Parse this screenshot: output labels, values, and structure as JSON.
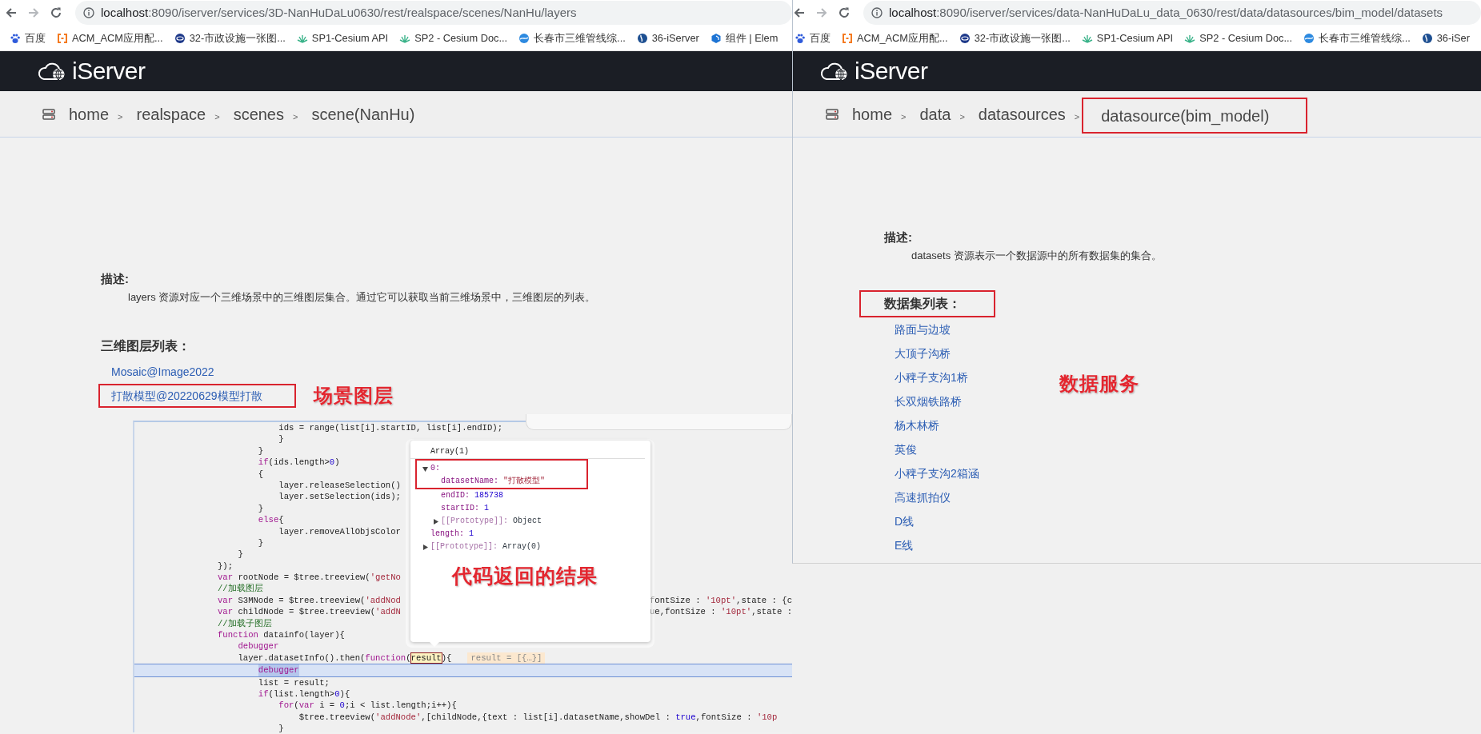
{
  "left_window": {
    "address_bar": {
      "host": "localhost",
      "path": ":8090/iserver/services/3D-NanHuDaLu0630/rest/realspace/scenes/NanHu/layers"
    },
    "bookmarks": [
      {
        "label": "百度",
        "kind": "paw"
      },
      {
        "label": "ACM_ACM应用配...",
        "kind": "bracket"
      },
      {
        "label": "32-市政设施一张图...",
        "kind": "ring"
      },
      {
        "label": "SP1-Cesium API",
        "kind": "leaf"
      },
      {
        "label": "SP2 - Cesium Doc...",
        "kind": "leaf"
      },
      {
        "label": "长春市三维管线综...",
        "kind": "globe"
      },
      {
        "label": "36-iServer",
        "kind": "disc"
      },
      {
        "label": "组件 | Elem",
        "kind": "hexagon"
      }
    ],
    "logo": "iServer",
    "breadcrumb": [
      {
        "label": "home",
        "separator": ">",
        "annotated": false
      },
      {
        "label": "realspace",
        "separator": ">",
        "annotated": false
      },
      {
        "label": "scenes",
        "separator": ">",
        "annotated": false
      },
      {
        "label": "scene(NanHu)",
        "annotated": false
      }
    ],
    "description_title": "描述:",
    "description": "layers 资源对应一个三维场景中的三维图层集合。通过它可以获取当前三维场景中，三维图层的列表。",
    "list_title": {
      "text": "三维图层列表：",
      "annotated": false
    },
    "items": [
      {
        "label": "Mosaic@Image2022",
        "annotated": false
      },
      {
        "label": "打散模型@20220629模型打散",
        "annotated": true
      }
    ],
    "annotation": "场景图层",
    "code": {
      "lines": [
        {
          "text": "            ids = range(list[i].startID, list[i].endID);",
          "current": false
        },
        {
          "text": "            }",
          "current": false
        },
        {
          "text": "        }",
          "current": false
        },
        {
          "text": "        if(ids.length>0)",
          "current": false
        },
        {
          "text": "        {",
          "current": false
        },
        {
          "text": "            layer.releaseSelection()",
          "current": false
        },
        {
          "text": "            layer.setSelection(ids);",
          "current": false
        },
        {
          "text": "        }",
          "current": false
        },
        {
          "text": "        else{",
          "current": false
        },
        {
          "text": "            layer.removeAllObjsColor",
          "current": false
        },
        {
          "text": "        }",
          "current": false
        },
        {
          "text": "    }",
          "current": false
        },
        {
          "text": "});",
          "current": false
        },
        {
          "text": "var rootNode = $tree.treeview('getNo",
          "current": false
        },
        {
          "text": "//加载图层",
          "current": false
        },
        {
          "text": "var S3MNode = $tree.treeview('addNod",
          "after": "fontSize : '10pt',state : {c",
          "current": false
        },
        {
          "text": "var childNode = $tree.treeview('addN",
          "after": "ue,fontSize : '10pt',state :",
          "current": false
        },
        {
          "text": "//加载子图层",
          "current": false
        },
        {
          "text": "function datainfo(layer){",
          "current": false
        },
        {
          "text": "    debugger",
          "current": false
        },
        {
          "text": "    layer.datasetInfo().then(function(",
          "token": "result",
          "tail": "){",
          "inline_value": "result = [{…}]",
          "current": false
        },
        {
          "text": "        debugger",
          "current": true
        },
        {
          "text": "        list = result;",
          "current": false
        },
        {
          "text": "        if(list.length>0){",
          "current": false
        },
        {
          "text": "            for(var i = 0;i < list.length;i++){",
          "current": false
        },
        {
          "text": "                $tree.treeview('addNode',[childNode,{text : list[i].datasetName,showDel : true,fontSize : '10p",
          "current": false
        },
        {
          "text": "            }",
          "current": false
        }
      ],
      "tooltip": {
        "title": "Array(1)",
        "entries": [
          {
            "key": "0:",
            "expanded": true,
            "annotated": true,
            "children": [
              {
                "key": "datasetName:",
                "value": "\"打散模型\"",
                "kind": "string"
              },
              {
                "key": "endID:",
                "value": "185738",
                "kind": "number"
              },
              {
                "key": "startID:",
                "value": "1",
                "kind": "number"
              },
              {
                "key": "[[Prototype]]:",
                "value": "Object",
                "kind": "object",
                "expanded": false
              }
            ]
          },
          {
            "key": "length:",
            "value": "1",
            "kind": "number",
            "annotated": false
          },
          {
            "key": "[[Prototype]]:",
            "value": "Array(0)",
            "kind": "object",
            "expanded": false,
            "annotated": false
          }
        ]
      },
      "annotation": "代码返回的结果"
    }
  },
  "right_window": {
    "address_bar": {
      "host": "localhost",
      "path": ":8090/iserver/services/data-NanHuDaLu_data_0630/rest/data/datasources/bim_model/datasets"
    },
    "bookmarks": [
      {
        "label": "百度",
        "kind": "paw"
      },
      {
        "label": "ACM_ACM应用配...",
        "kind": "bracket"
      },
      {
        "label": "32-市政设施一张图...",
        "kind": "ring"
      },
      {
        "label": "SP1-Cesium API",
        "kind": "leaf"
      },
      {
        "label": "SP2 - Cesium Doc...",
        "kind": "leaf"
      },
      {
        "label": "长春市三维管线综...",
        "kind": "globe"
      },
      {
        "label": "36-iSer",
        "kind": "disc"
      }
    ],
    "logo": "iServer",
    "breadcrumb": [
      {
        "label": "home",
        "separator": ">",
        "annotated": false
      },
      {
        "label": "data",
        "separator": ">",
        "annotated": false
      },
      {
        "label": "datasources",
        "separator": ">",
        "annotated": false
      },
      {
        "label": "datasource(bim_model)",
        "annotated": true
      }
    ],
    "description_title": "描述:",
    "description": "datasets 资源表示一个数据源中的所有数据集的集合。",
    "list_title": {
      "text": "数据集列表：",
      "annotated": true
    },
    "items": [
      {
        "label": "路面与边坡",
        "annotated": false
      },
      {
        "label": "大顶子沟桥",
        "annotated": false
      },
      {
        "label": "小稗子支沟1桥",
        "annotated": false
      },
      {
        "label": "长双烟铁路桥",
        "annotated": false
      },
      {
        "label": "杨木林桥",
        "annotated": false
      },
      {
        "label": "英俊",
        "annotated": false
      },
      {
        "label": "小稗子支沟2箱涵",
        "annotated": false
      },
      {
        "label": "高速抓拍仪",
        "annotated": false
      },
      {
        "label": "D线",
        "annotated": false
      },
      {
        "label": "E线",
        "annotated": false
      }
    ],
    "annotation": "数据服务"
  }
}
